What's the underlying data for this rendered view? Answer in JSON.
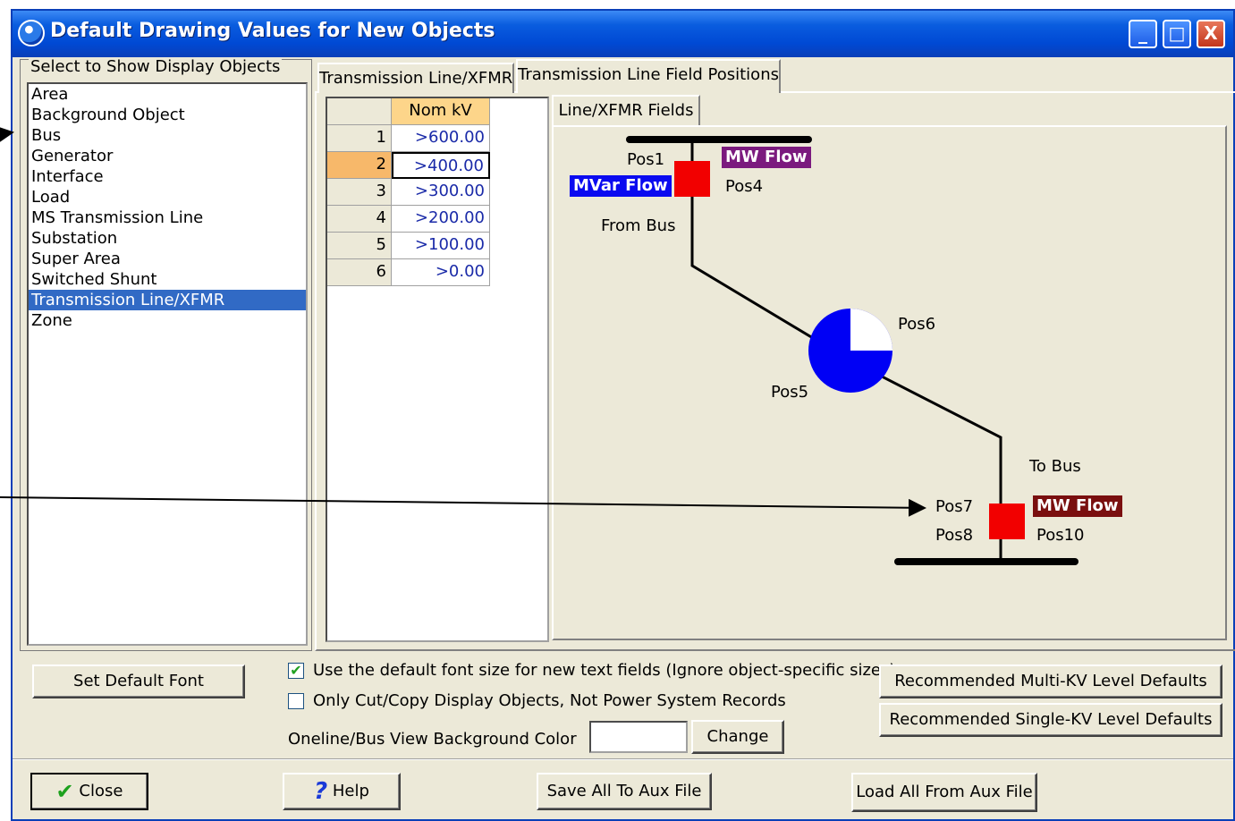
{
  "window": {
    "title": "Default Drawing Values for New Objects",
    "controls": {
      "minimize": "_",
      "maximize": "□",
      "close": "X"
    }
  },
  "left_panel": {
    "legend": "Select to Show Display Objects",
    "items": [
      {
        "label": "Area"
      },
      {
        "label": "Background Object"
      },
      {
        "label": "Bus"
      },
      {
        "label": "Generator"
      },
      {
        "label": "Interface"
      },
      {
        "label": "Load"
      },
      {
        "label": "MS Transmission Line"
      },
      {
        "label": "Substation"
      },
      {
        "label": "Super Area"
      },
      {
        "label": "Switched Shunt"
      },
      {
        "label": "Transmission Line/XFMR",
        "selected": true
      },
      {
        "label": "Zone"
      }
    ]
  },
  "tabs": {
    "tab1": "Transmission Line/XFMR",
    "tab2": "Transmission Line Field Positions",
    "inner_tab": "Line/XFMR Fields"
  },
  "grid": {
    "header": "Nom kV",
    "rows": [
      {
        "num": "1",
        "value": ">600.00"
      },
      {
        "num": "2",
        "value": ">400.00",
        "selected": true
      },
      {
        "num": "3",
        "value": ">300.00"
      },
      {
        "num": "4",
        "value": ">200.00"
      },
      {
        "num": "5",
        "value": ">100.00"
      },
      {
        "num": "6",
        "value": ">0.00"
      }
    ]
  },
  "diagram": {
    "labels": {
      "pos1": "Pos1",
      "pos4": "Pos4",
      "pos5": "Pos5",
      "pos6": "Pos6",
      "pos7": "Pos7",
      "pos8": "Pos8",
      "pos10": "Pos10",
      "from_bus": "From Bus",
      "to_bus": "To Bus"
    },
    "mw_flow_top": "MW Flow",
    "mvar_flow": "MVar Flow",
    "mw_flow_bottom": "MW Flow",
    "colors": {
      "mw_flow_top_bg": "#7b1a7e",
      "mvar_flow_bg": "#0a0af0",
      "mw_flow_bottom_bg": "#7a0f0f",
      "breaker": "#f20000",
      "pie": "#0000f5"
    }
  },
  "options": {
    "set_default_font": "Set Default Font",
    "use_default_font": {
      "label": "Use the default font size for new text fields (Ignore object-specific sizes)",
      "checked": true
    },
    "only_cut_copy": {
      "label": "Only Cut/Copy Display Objects, Not Power System Records",
      "checked": false
    },
    "bg_color_label": "Oneline/Bus View Background Color",
    "change": "Change",
    "multi_kv": "Recommended Multi-KV Level Defaults",
    "single_kv": "Recommended Single-KV Level Defaults"
  },
  "footer": {
    "close": "Close",
    "help": "Help",
    "save_aux": "Save All To Aux File",
    "load_aux": "Load All From Aux File"
  }
}
